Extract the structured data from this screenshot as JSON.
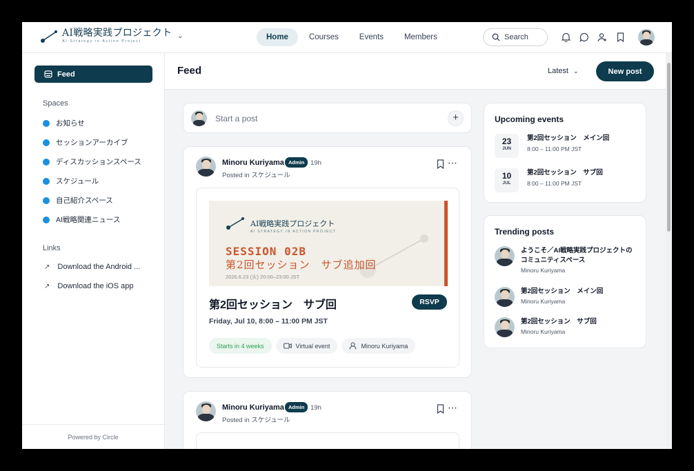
{
  "header": {
    "logo_title": "AI戦略実践プロジェクト",
    "logo_subtitle": "AI Strategy in Action Project",
    "nav": [
      "Home",
      "Courses",
      "Events",
      "Members"
    ],
    "search_label": "Search"
  },
  "sidebar": {
    "feed_label": "Feed",
    "spaces_heading": "Spaces",
    "spaces": [
      "お知らせ",
      "セッションアーカイブ",
      "ディスカッションスペース",
      "スケジュール",
      "自己紹介スペース",
      "AI戦略関連ニュース"
    ],
    "links_heading": "Links",
    "links": [
      "Download the Android ...",
      "Download the iOS app"
    ],
    "powered_by": "Powered by Circle"
  },
  "main": {
    "title": "Feed",
    "sort": "Latest",
    "new_post": "New post",
    "start_post_placeholder": "Start a post"
  },
  "posts": [
    {
      "author": "Minoru Kuriyama",
      "badge": "Admin",
      "time": "19h",
      "posted_in": "Posted in スケジュール",
      "banner": {
        "logo_title": "AI戦略実践プロジェクト",
        "logo_subtitle": "AI STRATEGY IN ACTION PROJECT",
        "session": "SESSION 02B",
        "jp_title": "第2回セッション　サブ追加回",
        "date": "2026.6.23 (火) 20:00–23:00 JST"
      },
      "event_title": "第2回セッション　サブ回",
      "rsvp": "RSVP",
      "event_date": "Friday, Jul 10, 8:00 – 11:00 PM JST",
      "tags": [
        "Starts in 4 weeks",
        "Virtual event",
        "Minoru Kuriyama"
      ]
    },
    {
      "author": "Minoru Kuriyama",
      "badge": "Admin",
      "time": "19h",
      "posted_in": "Posted in スケジュール"
    }
  ],
  "upcoming": {
    "title": "Upcoming events",
    "events": [
      {
        "day": "23",
        "month": "JUN",
        "title": "第2回セッション　メイン回",
        "time": "8:00 – 11:00 PM JST"
      },
      {
        "day": "10",
        "month": "JUL",
        "title": "第2回セッション　サブ回",
        "time": "8:00 – 11:00 PM JST"
      }
    ]
  },
  "trending": {
    "title": "Trending posts",
    "posts": [
      {
        "title": "ようこそ／AI戦略実践プロジェクトのコミュニティスペース",
        "author": "Minoru Kuriyama"
      },
      {
        "title": "第2回セッション　メイン回",
        "author": "Minoru Kuriyama"
      },
      {
        "title": "第2回セッション　サブ回",
        "author": "Minoru Kuriyama"
      }
    ]
  },
  "colors": {
    "primary": "#0e3b4d",
    "space_dot": "#1b8fe0",
    "accent": "#c9552e",
    "green": "#2f9e57"
  }
}
